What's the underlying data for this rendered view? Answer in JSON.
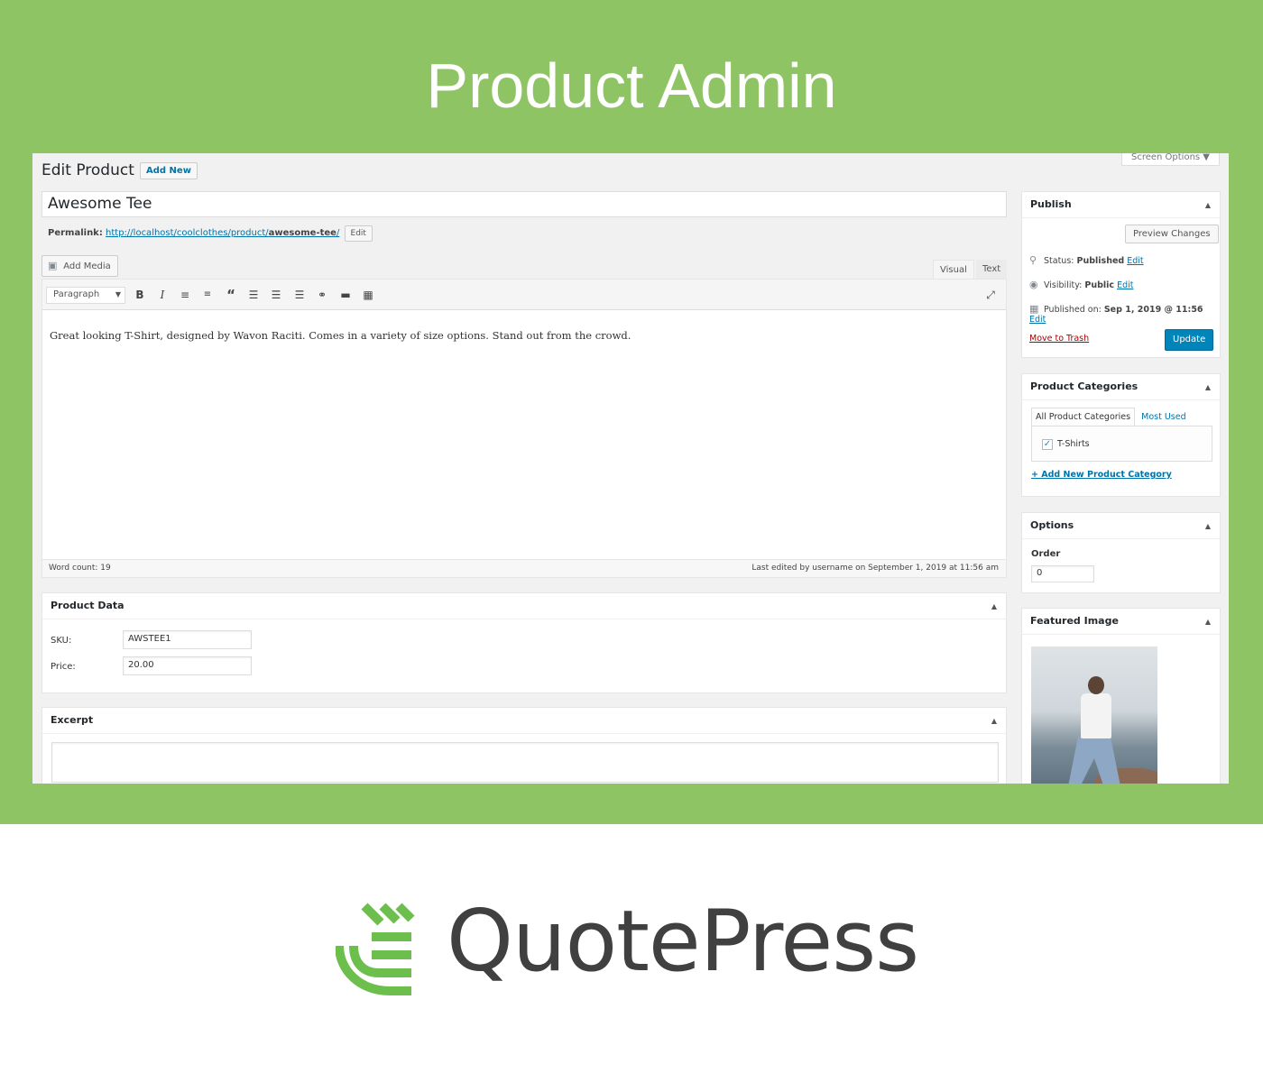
{
  "banner": {
    "title": "Product Admin"
  },
  "header": {
    "page_title": "Edit Product",
    "add_new_label": "Add New",
    "screen_options_label": "Screen Options ▼"
  },
  "post": {
    "title": "Awesome Tee",
    "permalink_label": "Permalink:",
    "permalink_url": "http://localhost/coolclothes/product/",
    "permalink_slug": "awesome-tee",
    "permalink_suffix": "/",
    "permalink_edit_label": "Edit"
  },
  "editor": {
    "add_media_label": "Add Media",
    "tabs": {
      "visual": "Visual",
      "text": "Text"
    },
    "format_select": "Paragraph",
    "content": "Great looking T-Shirt, designed by Wavon Raciti. Comes in a variety of size options. Stand out from the crowd.",
    "word_count": "Word count: 19",
    "last_edited": "Last edited by username on September 1, 2019 at 11:56 am",
    "toolbar_icons": [
      "bold-icon",
      "italic-icon",
      "bullet-list-icon",
      "numbered-list-icon",
      "blockquote-icon",
      "align-left-icon",
      "align-center-icon",
      "align-right-icon",
      "link-icon",
      "read-more-icon",
      "toolbar-toggle-icon",
      "fullscreen-icon"
    ]
  },
  "product_data": {
    "title": "Product Data",
    "sku_label": "SKU:",
    "sku_value": "AWSTEE1",
    "price_label": "Price:",
    "price_value": "20.00"
  },
  "excerpt": {
    "title": "Excerpt",
    "value": ""
  },
  "publish": {
    "title": "Publish",
    "preview_label": "Preview Changes",
    "status_label": "Status:",
    "status_value": "Published",
    "visibility_label": "Visibility:",
    "visibility_value": "Public",
    "published_label": "Published on:",
    "published_value": "Sep 1, 2019 @ 11:56",
    "edit_label": "Edit",
    "trash_label": "Move to Trash",
    "update_label": "Update"
  },
  "categories": {
    "title": "Product Categories",
    "tab_all": "All Product Categories",
    "tab_most_used": "Most Used",
    "items": [
      {
        "label": "T-Shirts",
        "checked": true
      }
    ],
    "add_new_label": "+ Add New Product Category"
  },
  "options": {
    "title": "Options",
    "order_label": "Order",
    "order_value": "0"
  },
  "featured_image": {
    "title": "Featured Image"
  },
  "brand": {
    "name": "QuotePress",
    "colors": {
      "green": "#8fc464",
      "logo_green": "#6cbf4c",
      "text": "#404040",
      "accent": "#0073aa"
    }
  }
}
